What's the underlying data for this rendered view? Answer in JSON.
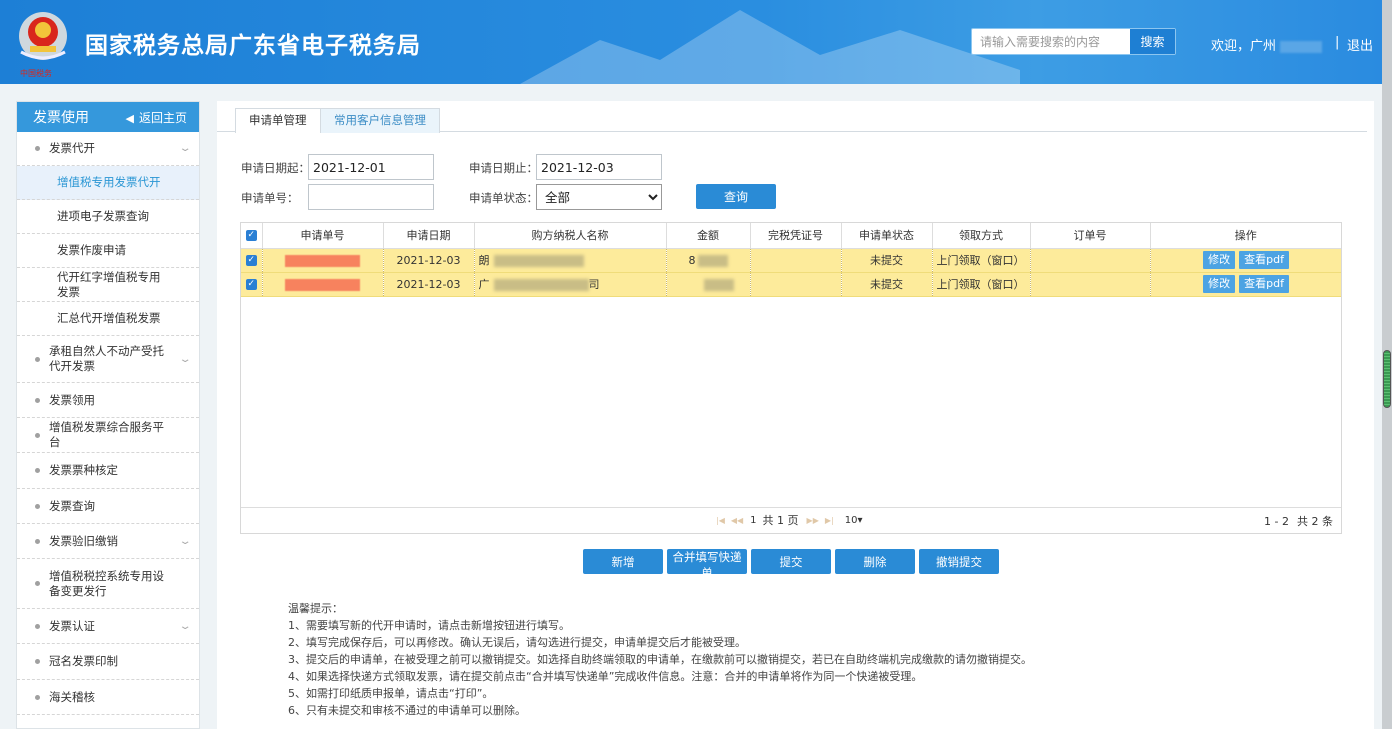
{
  "header": {
    "title": "国家税务总局广东省电子税务局",
    "emblem_caption": "中国税务",
    "search_placeholder": "请输入需要搜索的内容",
    "search_button": "搜索",
    "welcome": "欢迎，广州",
    "separator": "|",
    "logout": "退出"
  },
  "sidebar": {
    "title": "发票使用",
    "back_label": "返回主页",
    "items": [
      {
        "label": "发票代开",
        "level": 1,
        "expandable": true
      },
      {
        "label": "增值税专用发票代开",
        "level": 2,
        "active": true
      },
      {
        "label": "进项电子发票查询",
        "level": 2
      },
      {
        "label": "发票作废申请",
        "level": 2
      },
      {
        "label": "代开红字增值税专用发票",
        "level": 2
      },
      {
        "label": "汇总代开增值税发票",
        "level": 2
      },
      {
        "label": "承租自然人不动产受托代开发票",
        "level": 1,
        "expandable": true
      },
      {
        "label": "发票领用",
        "level": 1
      },
      {
        "label": "增值税发票综合服务平台",
        "level": 1
      },
      {
        "label": "发票票种核定",
        "level": 1
      },
      {
        "label": "发票查询",
        "level": 1
      },
      {
        "label": "发票验旧缴销",
        "level": 1,
        "expandable": true
      },
      {
        "label": "增值税税控系统专用设备变更发行",
        "level": 1
      },
      {
        "label": "发票认证",
        "level": 1,
        "expandable": true
      },
      {
        "label": "冠名发票印制",
        "level": 1
      },
      {
        "label": "海关稽核",
        "level": 1
      }
    ]
  },
  "tabs": [
    {
      "label": "申请单管理",
      "active": true
    },
    {
      "label": "常用客户信息管理",
      "active": false
    }
  ],
  "form": {
    "date_from_label": "申请日期起：",
    "date_from_value": "2021-12-01",
    "date_to_label": "申请日期止：",
    "date_to_value": "2021-12-03",
    "order_no_label": "申请单号：",
    "order_no_value": "",
    "status_label": "申请单状态：",
    "status_value": "全部",
    "query_button": "查询"
  },
  "table": {
    "columns": [
      "申请单号",
      "申请日期",
      "购方纳税人名称",
      "金额",
      "完税凭证号",
      "申请单状态",
      "领取方式",
      "订单号",
      "操作"
    ],
    "rows": [
      {
        "checked": true,
        "order_no_prefix": "",
        "date": "2021-12-03",
        "buyer_prefix": "朗",
        "buyer_suffix": "",
        "amount_prefix": "8",
        "tax_receipt": "",
        "status": "未提交",
        "pickup": "上门领取（窗口）",
        "order": "",
        "actions": [
          "修改",
          "查看pdf"
        ]
      },
      {
        "checked": true,
        "order_no_prefix": "",
        "date": "2021-12-03",
        "buyer_prefix": "广",
        "buyer_suffix": "司",
        "amount_prefix": "",
        "tax_receipt": "",
        "status": "未提交",
        "pickup": "上门领取（窗口）",
        "order": "",
        "actions": [
          "修改",
          "查看pdf"
        ]
      }
    ],
    "header_checked": true,
    "pager": {
      "current_page": "1",
      "total_pages_text": "共 1 页",
      "page_size": "10",
      "range_text": "1 - 2",
      "total_text": "共 2 条"
    }
  },
  "actions": [
    "新增",
    "合并填写快递单",
    "提交",
    "删除",
    "撤销提交"
  ],
  "tips": {
    "title": "温馨提示：",
    "lines": [
      "1、需要填写新的代开申请时，请点击新增按钮进行填写。",
      "2、填写完成保存后，可以再修改。确认无误后，请勾选进行提交，申请单提交后才能被受理。",
      "3、提交后的申请单，在被受理之前可以撤销提交。如选择自助终端领取的申请单，在缴款前可以撤销提交，若已在自助终端机完成缴款的请勿撤销提交。",
      "4、如果选择快递方式领取发票，请在提交前点击“合并填写快递单”完成收件信息。注意：合并的申请单将作为同一个快递被受理。",
      "5、如需打印纸质申报单，请点击“打印”。",
      "6、只有未提交和审核不通过的申请单可以删除。"
    ]
  },
  "colors": {
    "header_blue": "#2a8be0",
    "sidebar_head": "#3598dc",
    "button_blue": "#2a8bd6",
    "row_highlight": "#fdeb9b",
    "status_red": "#dd3333"
  }
}
